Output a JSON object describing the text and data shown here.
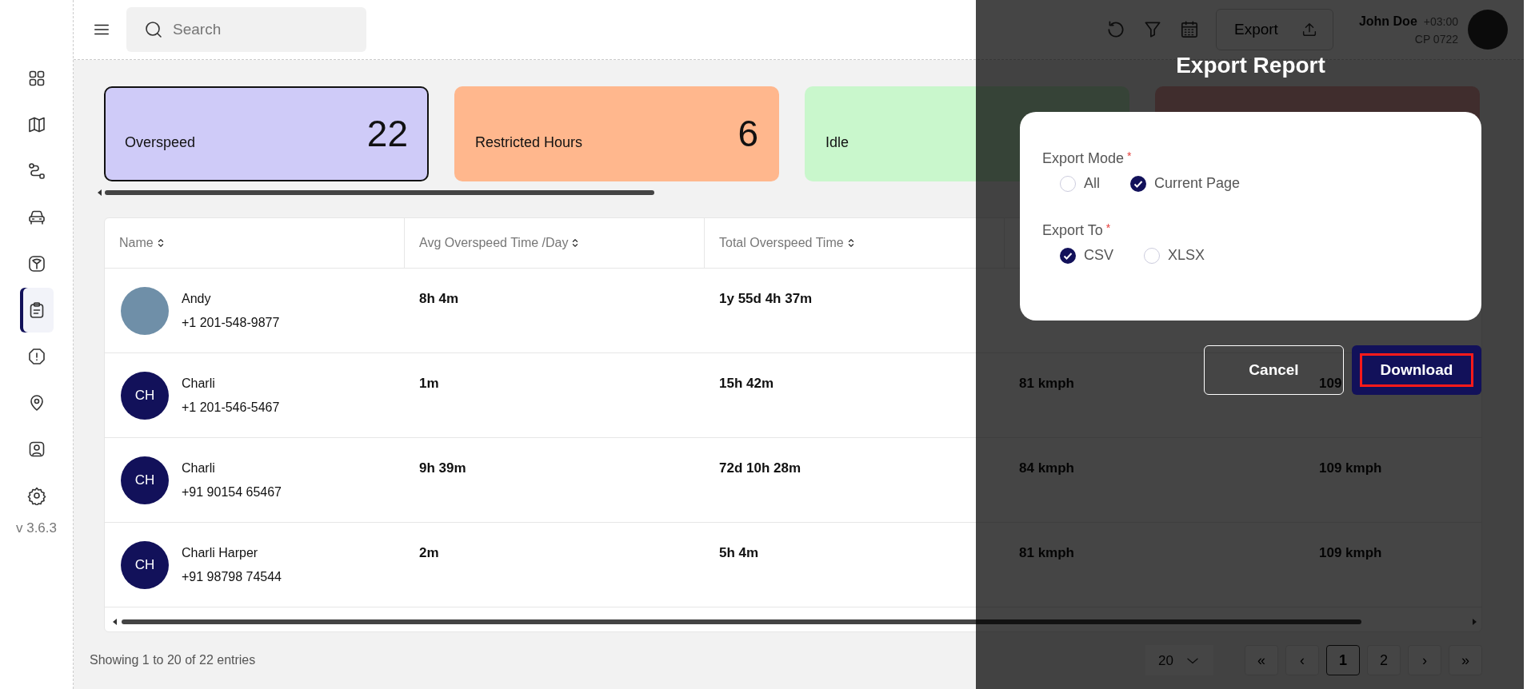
{
  "sidebar": {
    "items": [
      {
        "selected": false
      },
      {
        "selected": false
      },
      {
        "selected": false
      },
      {
        "selected": false
      },
      {
        "selected": false
      },
      {
        "selected": true
      },
      {
        "selected": false
      },
      {
        "selected": false
      },
      {
        "selected": false
      },
      {
        "selected": false
      }
    ],
    "version": "v 3.6.3"
  },
  "topbar": {
    "search": {
      "placeholder": "Search"
    },
    "export_button": "Export",
    "user": {
      "name": "John Doe",
      "timezone": "+03:00",
      "code": "CP 0722"
    }
  },
  "cards": [
    {
      "label": "Overspeed",
      "value": "22",
      "color": "#cfcbf8",
      "selected": true
    },
    {
      "label": "Restricted Hours",
      "value": "6",
      "color": "#ffb78d",
      "selected": false
    },
    {
      "label": "Idle",
      "color": "#c9f7cc",
      "selected": false
    },
    {
      "color": "#402d2d",
      "selected": false
    }
  ],
  "table": {
    "columns": [
      "Name",
      "Avg Overspeed Time /Day",
      "Total Overspeed Time"
    ],
    "rows": [
      {
        "cells": [
          {
            "name": "Andy",
            "phone": "+1 201-548-9877",
            "avatar": {
              "kind": "photo"
            }
          },
          "8h 4m",
          "1y 55d 4h 37m"
        ]
      },
      {
        "cells": [
          {
            "name": "Charli",
            "phone": "+1 201-546-5467",
            "avatar": {
              "kind": "initials",
              "text": "CH"
            }
          },
          "1m",
          "15h 42m",
          "81 kmph",
          "109"
        ]
      },
      {
        "cells": [
          {
            "name": "Charli",
            "phone": "+91 90154 65467",
            "avatar": {
              "kind": "initials",
              "text": "CH"
            }
          },
          "9h 39m",
          "72d 10h 28m",
          "84 kmph",
          "109 kmph"
        ]
      },
      {
        "cells": [
          {
            "name": "Charli Harper",
            "phone": "+91 98798 74544",
            "avatar": {
              "kind": "initials",
              "text": "CH"
            }
          },
          "2m",
          "5h 4m",
          "81 kmph",
          "109 kmph"
        ]
      }
    ]
  },
  "footer": {
    "summary": "Showing 1 to 20 of 22 entries",
    "page_size": "20",
    "pages": [
      {
        "label": "«",
        "selected": false
      },
      {
        "label": "‹",
        "selected": false
      },
      {
        "label": "1",
        "selected": true
      },
      {
        "label": "2",
        "selected": false
      },
      {
        "label": "›",
        "selected": false
      },
      {
        "label": "»",
        "selected": false
      }
    ]
  },
  "dialog": {
    "title": "Export Report",
    "groups": [
      {
        "label": "Export Mode",
        "required_mark": "*",
        "options": [
          {
            "label": "All",
            "selected": false
          },
          {
            "label": "Current Page",
            "selected": true
          }
        ]
      },
      {
        "label": "Export To",
        "required_mark": "*",
        "options": [
          {
            "label": "CSV",
            "selected": true
          },
          {
            "label": "XLSX",
            "selected": false
          }
        ]
      }
    ],
    "buttons": [
      {
        "label": "Cancel",
        "kind": "secondary",
        "highlighted": false
      },
      {
        "label": "Download",
        "kind": "primary",
        "highlighted": true
      }
    ]
  }
}
